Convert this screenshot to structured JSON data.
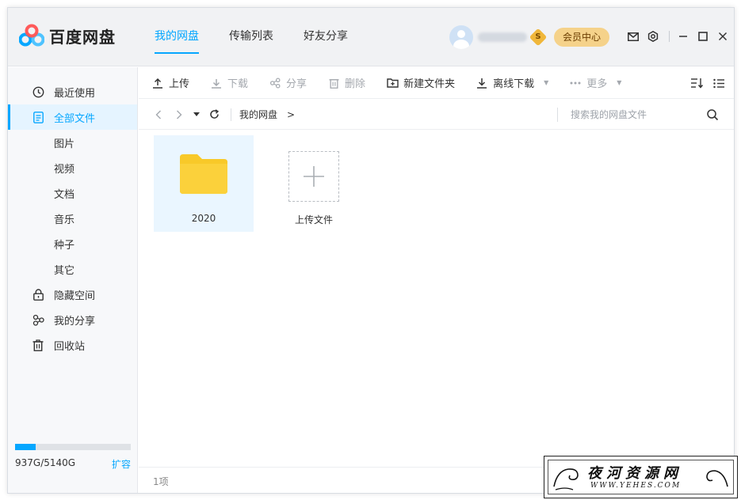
{
  "app": {
    "title": "百度网盘"
  },
  "main_tabs": [
    {
      "label": "我的网盘",
      "active": true
    },
    {
      "label": "传输列表",
      "active": false
    },
    {
      "label": "好友分享",
      "active": false
    }
  ],
  "user": {
    "member_center": "会员中心",
    "vip_symbol": "S"
  },
  "sidebar": {
    "items": [
      {
        "label": "最近使用",
        "icon": "clock-icon",
        "type": "main",
        "active": false
      },
      {
        "label": "全部文件",
        "icon": "file-icon",
        "type": "main",
        "active": true
      },
      {
        "label": "图片",
        "type": "sub"
      },
      {
        "label": "视频",
        "type": "sub"
      },
      {
        "label": "文档",
        "type": "sub"
      },
      {
        "label": "音乐",
        "type": "sub"
      },
      {
        "label": "种子",
        "type": "sub"
      },
      {
        "label": "其它",
        "type": "sub"
      },
      {
        "label": "隐藏空间",
        "icon": "lock-icon",
        "type": "main",
        "active": false
      },
      {
        "label": "我的分享",
        "icon": "share-icon",
        "type": "main",
        "active": false
      },
      {
        "label": "回收站",
        "icon": "trash-icon",
        "type": "main",
        "active": false
      }
    ],
    "storage": {
      "used_fraction": 0.18,
      "text": "937G/5140G",
      "expand_label": "扩容"
    }
  },
  "toolbar": {
    "upload": "上传",
    "download": "下载",
    "share": "分享",
    "delete": "删除",
    "new_folder": "新建文件夹",
    "offline_download": "离线下载",
    "more": "更多"
  },
  "nav": {
    "breadcrumb_root": "我的网盘",
    "breadcrumb_arrow": ">",
    "search_placeholder": "搜索我的网盘文件"
  },
  "files": [
    {
      "name": "2020",
      "type": "folder",
      "selected": true
    },
    {
      "name": "上传文件",
      "type": "upload"
    }
  ],
  "status": {
    "count": "1项"
  },
  "watermark": {
    "title": "夜河资源网",
    "url": "WWW.YEHES.COM"
  },
  "colors": {
    "accent": "#06a7ff",
    "folder": "#f8c929",
    "member": "#f5d28a"
  }
}
